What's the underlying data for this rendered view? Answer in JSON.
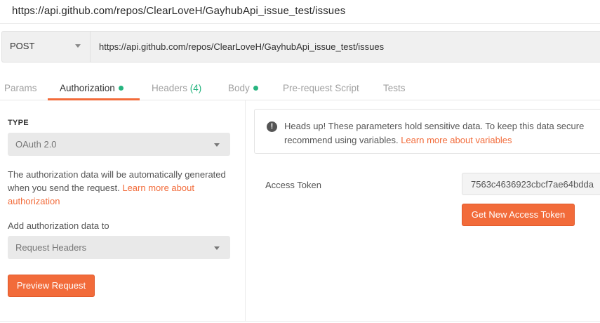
{
  "title_url": "https://api.github.com/repos/ClearLoveH/GayhubApi_issue_test/issues",
  "request": {
    "method": "POST",
    "url": "https://api.github.com/repos/ClearLoveH/GayhubApi_issue_test/issues"
  },
  "tabs": {
    "params": "Params",
    "authorization": "Authorization",
    "headers": "Headers",
    "headers_count": "(4)",
    "body": "Body",
    "prerequest": "Pre-request Script",
    "tests": "Tests"
  },
  "auth": {
    "type_label": "TYPE",
    "type_value": "OAuth 2.0",
    "desc_text": "The authorization data will be automatically generated when you send the request. ",
    "desc_link": "Learn more about authorization",
    "add_label": "Add authorization data to",
    "add_value": "Request Headers",
    "preview_button": "Preview Request"
  },
  "notice": {
    "icon": "!",
    "text": "Heads up! These parameters hold sensitive data. To keep this data secure recommend using variables. ",
    "link": "Learn more about variables"
  },
  "token": {
    "label": "Access Token",
    "value": "7563c4636923cbcf7ae64bdda",
    "get_button": "Get New Access Token"
  },
  "colors": {
    "accent": "#f26b3a",
    "status_green": "#26b47f"
  }
}
